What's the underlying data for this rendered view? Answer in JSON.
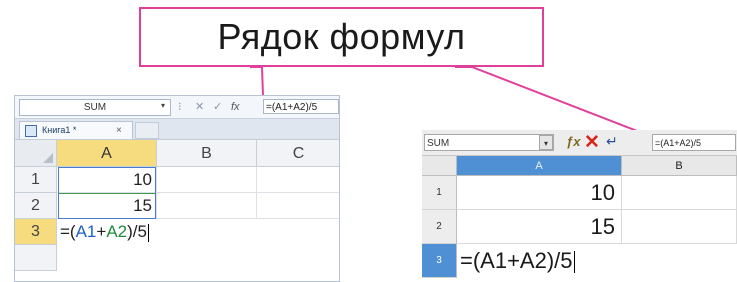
{
  "callout": {
    "label": "Рядок формул",
    "border_color": "#e0409a"
  },
  "left_excel": {
    "name_box": "SUM",
    "formula_buttons": {
      "cancel": "✕",
      "enter": "✓",
      "fx": "fx"
    },
    "formula_text": "=(A1+A2)/5",
    "tab_label": "Книга1 *",
    "tab_close": "×",
    "columns": [
      "A",
      "B",
      "C"
    ],
    "selected_column": "A",
    "rows": [
      {
        "header": "1",
        "value": "10"
      },
      {
        "header": "2",
        "value": "15"
      },
      {
        "header": "3",
        "formula_parts": [
          "=(",
          "A1",
          "+",
          "A2",
          ")/5"
        ]
      }
    ],
    "colors": {
      "selection": "#f7dc7f",
      "ref_a1": "#1f5fbf",
      "ref_a2": "#1e8a3a"
    }
  },
  "right_calc": {
    "name_box": "SUM",
    "formula_text": "=(A1+A2)/5",
    "columns": [
      "A",
      "B"
    ],
    "selected_column": "A",
    "rows": [
      {
        "header": "1",
        "value": "10"
      },
      {
        "header": "2",
        "value": "15"
      },
      {
        "header": "3",
        "formula": "=(A1+A2)/5"
      }
    ],
    "colors": {
      "selection": "#4f8fd4",
      "cancel": "#d8261b"
    }
  }
}
